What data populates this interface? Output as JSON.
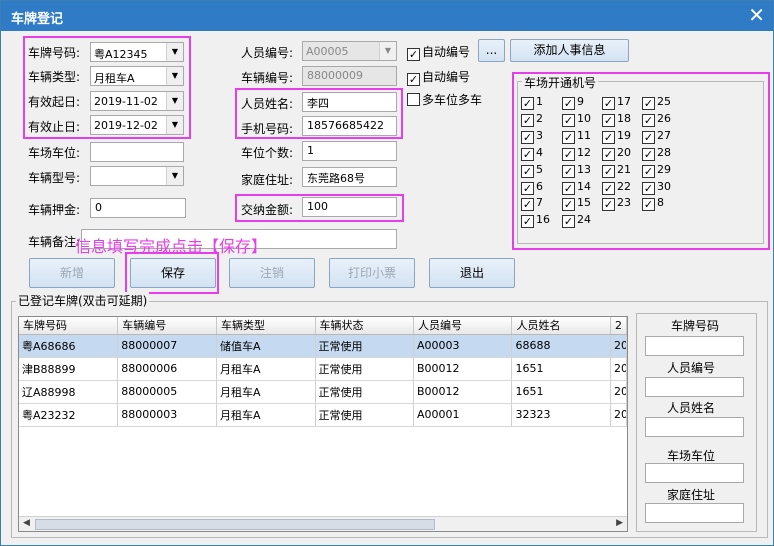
{
  "window": {
    "title": "车牌登记",
    "close_symbol": "✕"
  },
  "form": {
    "plate_label": "车牌号码:",
    "plate_value": "粤A12345",
    "type_label": "车辆类型:",
    "type_value": "月租车A",
    "start_label": "有效起日:",
    "start_value": "2019-11-02",
    "end_label": "有效止日:",
    "end_value": "2019-12-02",
    "space_label": "车场车位:",
    "space_value": "",
    "model_label": "车辆型号:",
    "model_value": "",
    "deposit_label": "车辆押金:",
    "deposit_value": "0",
    "remark_label": "车辆备注:",
    "remark_value": "",
    "person_no_label": "人员编号:",
    "person_no_value": "A00005",
    "vehicle_no_label": "车辆编号:",
    "vehicle_no_value": "88000009",
    "name_label": "人员姓名:",
    "name_value": "李四",
    "phone_label": "手机号码:",
    "phone_value": "18576685422",
    "slots_label": "车位个数:",
    "slots_value": "1",
    "address_label": "家庭住址:",
    "address_value": "东莞路68号",
    "fee_label": "交纳金额:",
    "fee_value": "100",
    "auto_no_1": "自动编号",
    "auto_no_2": "自动编号",
    "multi_car": "多车位多车",
    "dots_button": "...",
    "add_personnel_button": "添加人事信息"
  },
  "stations": {
    "title": "车场开通机号",
    "items": [
      "1",
      "9",
      "17",
      "25",
      "2",
      "10",
      "18",
      "26",
      "3",
      "11",
      "19",
      "27",
      "4",
      "12",
      "20",
      "28",
      "5",
      "13",
      "21",
      "29",
      "6",
      "14",
      "22",
      "30",
      "7",
      "15",
      "23",
      "8",
      "16",
      "24"
    ]
  },
  "tip": "信息填写完成点击【保存】",
  "buttons": {
    "add": "新增",
    "save": "保存",
    "cancel": "注销",
    "print": "打印小票",
    "exit": "退出"
  },
  "grid": {
    "title": "已登记车牌(双击可延期)",
    "columns": [
      "车牌号码",
      "车辆编号",
      "车辆类型",
      "车辆状态",
      "人员编号",
      "人员姓名",
      "2"
    ],
    "rows": [
      [
        "粤A68686",
        "88000007",
        "储值车A",
        "正常使用",
        "A00003",
        "68688",
        "20"
      ],
      [
        "津B88899",
        "88000006",
        "月租车A",
        "正常使用",
        "B00012",
        "1651",
        "20"
      ],
      [
        "辽A88998",
        "88000005",
        "月租车A",
        "正常使用",
        "B00012",
        "1651",
        "20"
      ],
      [
        "粤A23232",
        "88000003",
        "月租车A",
        "正常使用",
        "A00001",
        "32323",
        "20"
      ]
    ]
  },
  "search": {
    "plate": "车牌号码",
    "person_no": "人员编号",
    "name": "人员姓名",
    "space": "车场车位",
    "address": "家庭住址"
  },
  "colors": {
    "highlight": "#e43fe8",
    "titlebar": "#2f7bc6",
    "selected_row": "#c5d9f1"
  }
}
